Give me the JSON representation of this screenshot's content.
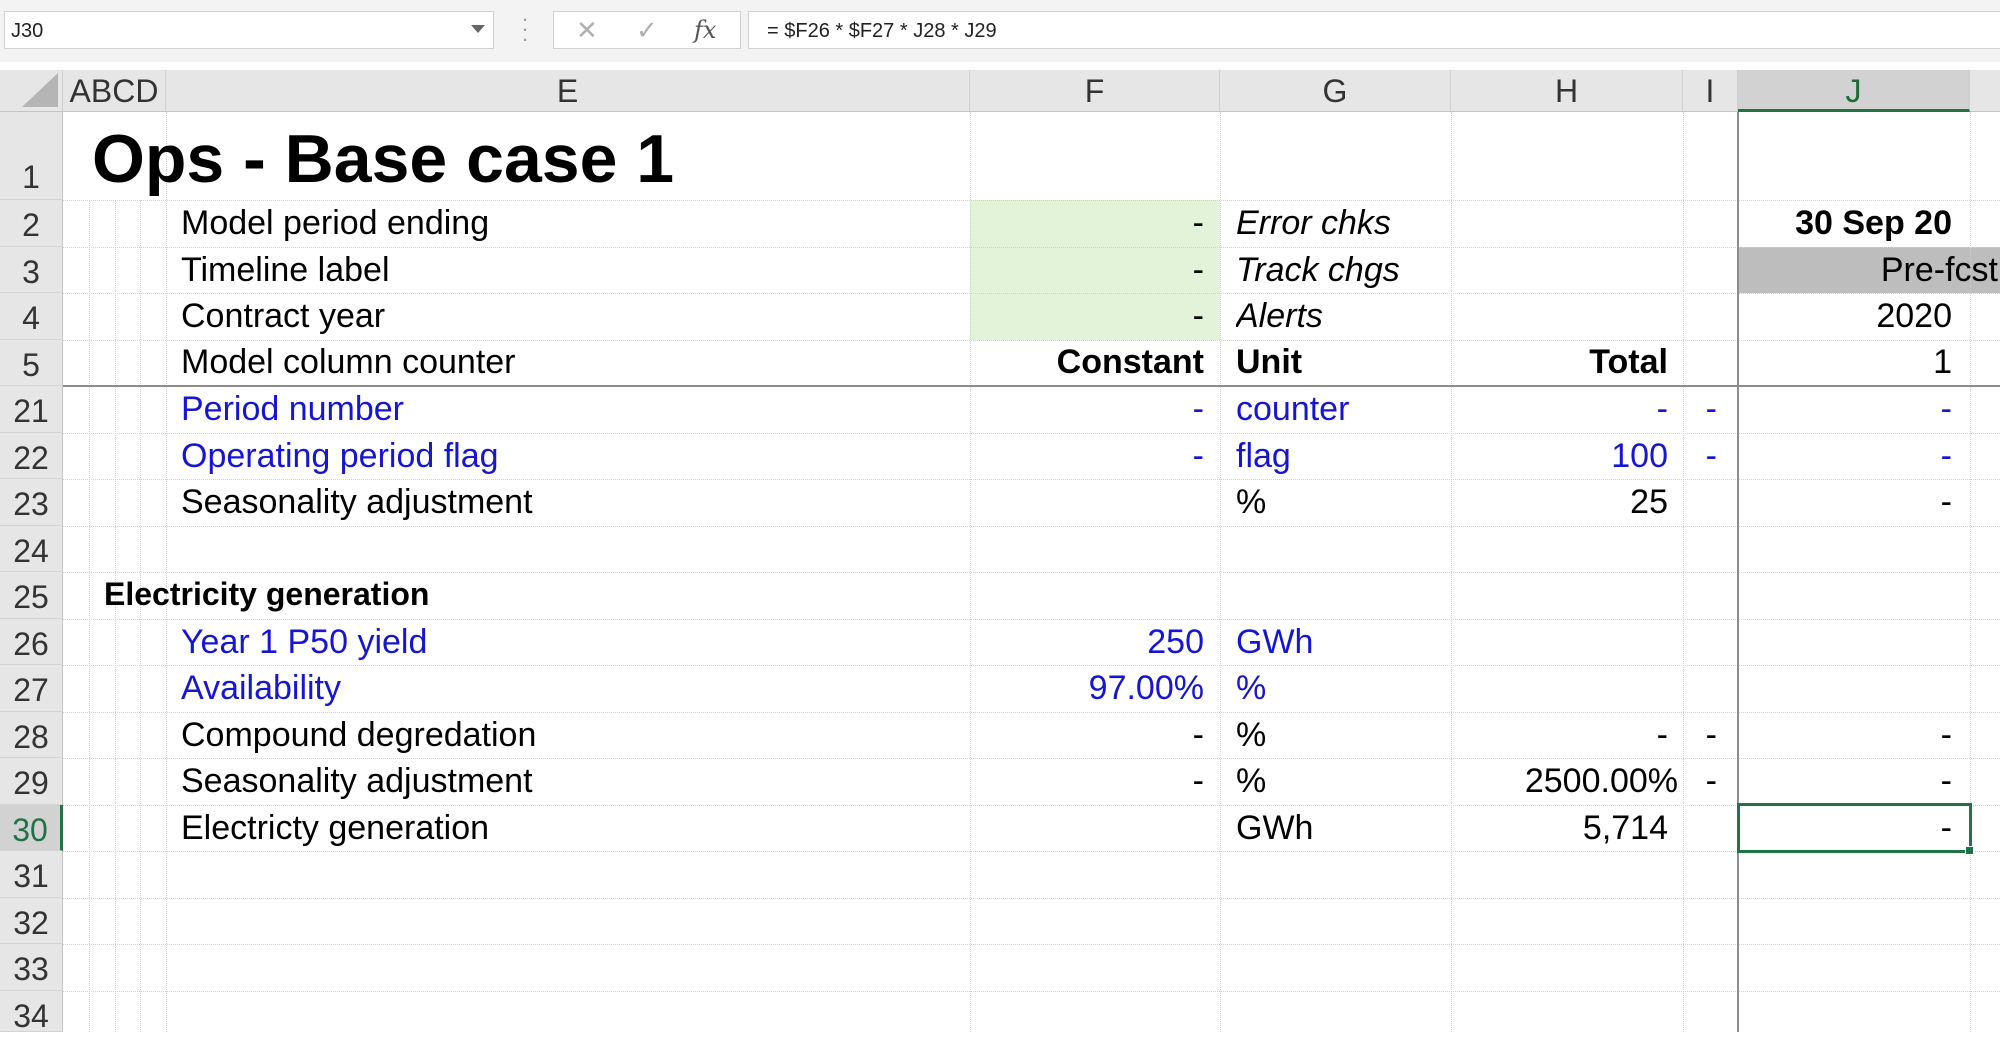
{
  "formula_bar": {
    "name_box": "J30",
    "cancel_icon": "✕",
    "enter_icon": "✓",
    "fx_label": "fx",
    "formula": "= $F26 * $F27 * J28 * J29"
  },
  "columns": [
    "ABCD",
    "E",
    "F",
    "G",
    "H",
    "I",
    "J"
  ],
  "selected_column": "J",
  "selected_row": "30",
  "title": "Ops - Base case 1",
  "header_rows": [
    {
      "row": "2",
      "label": "Model period ending",
      "F": "-",
      "G": "Error chks",
      "J": "30 Sep 20"
    },
    {
      "row": "3",
      "label": "Timeline label",
      "F": "-",
      "G": "Track chgs",
      "J": "Pre-fcst"
    },
    {
      "row": "4",
      "label": "Contract year",
      "F": "-",
      "G": "Alerts",
      "J": "2020"
    },
    {
      "row": "5",
      "label": "Model column counter",
      "F": "Constant",
      "G": "Unit",
      "H": "Total",
      "J": "1"
    }
  ],
  "rows": [
    {
      "row": "21",
      "label": "Period number",
      "F": "-",
      "G": "counter",
      "H": "-",
      "I": "-",
      "J": "-",
      "blue": true
    },
    {
      "row": "22",
      "label": "Operating period flag",
      "F": "-",
      "G": "flag",
      "H": "100",
      "I": "-",
      "J": "-",
      "blue": true
    },
    {
      "row": "23",
      "label": "Seasonality adjustment",
      "F": "",
      "G": "%",
      "H": "25",
      "I": "",
      "J": "-"
    },
    {
      "row": "24",
      "label": ""
    },
    {
      "row": "25",
      "section": "Electricity generation"
    },
    {
      "row": "26",
      "label": "Year 1 P50 yield",
      "F": "250",
      "G": "GWh",
      "blue": true
    },
    {
      "row": "27",
      "label": "Availability",
      "F": "97.00%",
      "G": "%",
      "blue": true
    },
    {
      "row": "28",
      "label": "Compound degredation",
      "F": "-",
      "G": "%",
      "H": "-",
      "I": "-",
      "J": "-"
    },
    {
      "row": "29",
      "label": "Seasonality adjustment",
      "F": "-",
      "G": "%",
      "H": "2500.00%",
      "I": "-",
      "J": "-"
    },
    {
      "row": "30",
      "label": "Electricty generation",
      "F": "",
      "G": "GWh",
      "H": "5,714",
      "I": "",
      "J": "-"
    },
    {
      "row": "31"
    },
    {
      "row": "32"
    },
    {
      "row": "33"
    },
    {
      "row": "34"
    }
  ],
  "colors": {
    "input_blue": "#1515d6",
    "input_fill": "#e3f3d9",
    "timeline_fill": "#bdbdbd",
    "selection_green": "#217346"
  }
}
